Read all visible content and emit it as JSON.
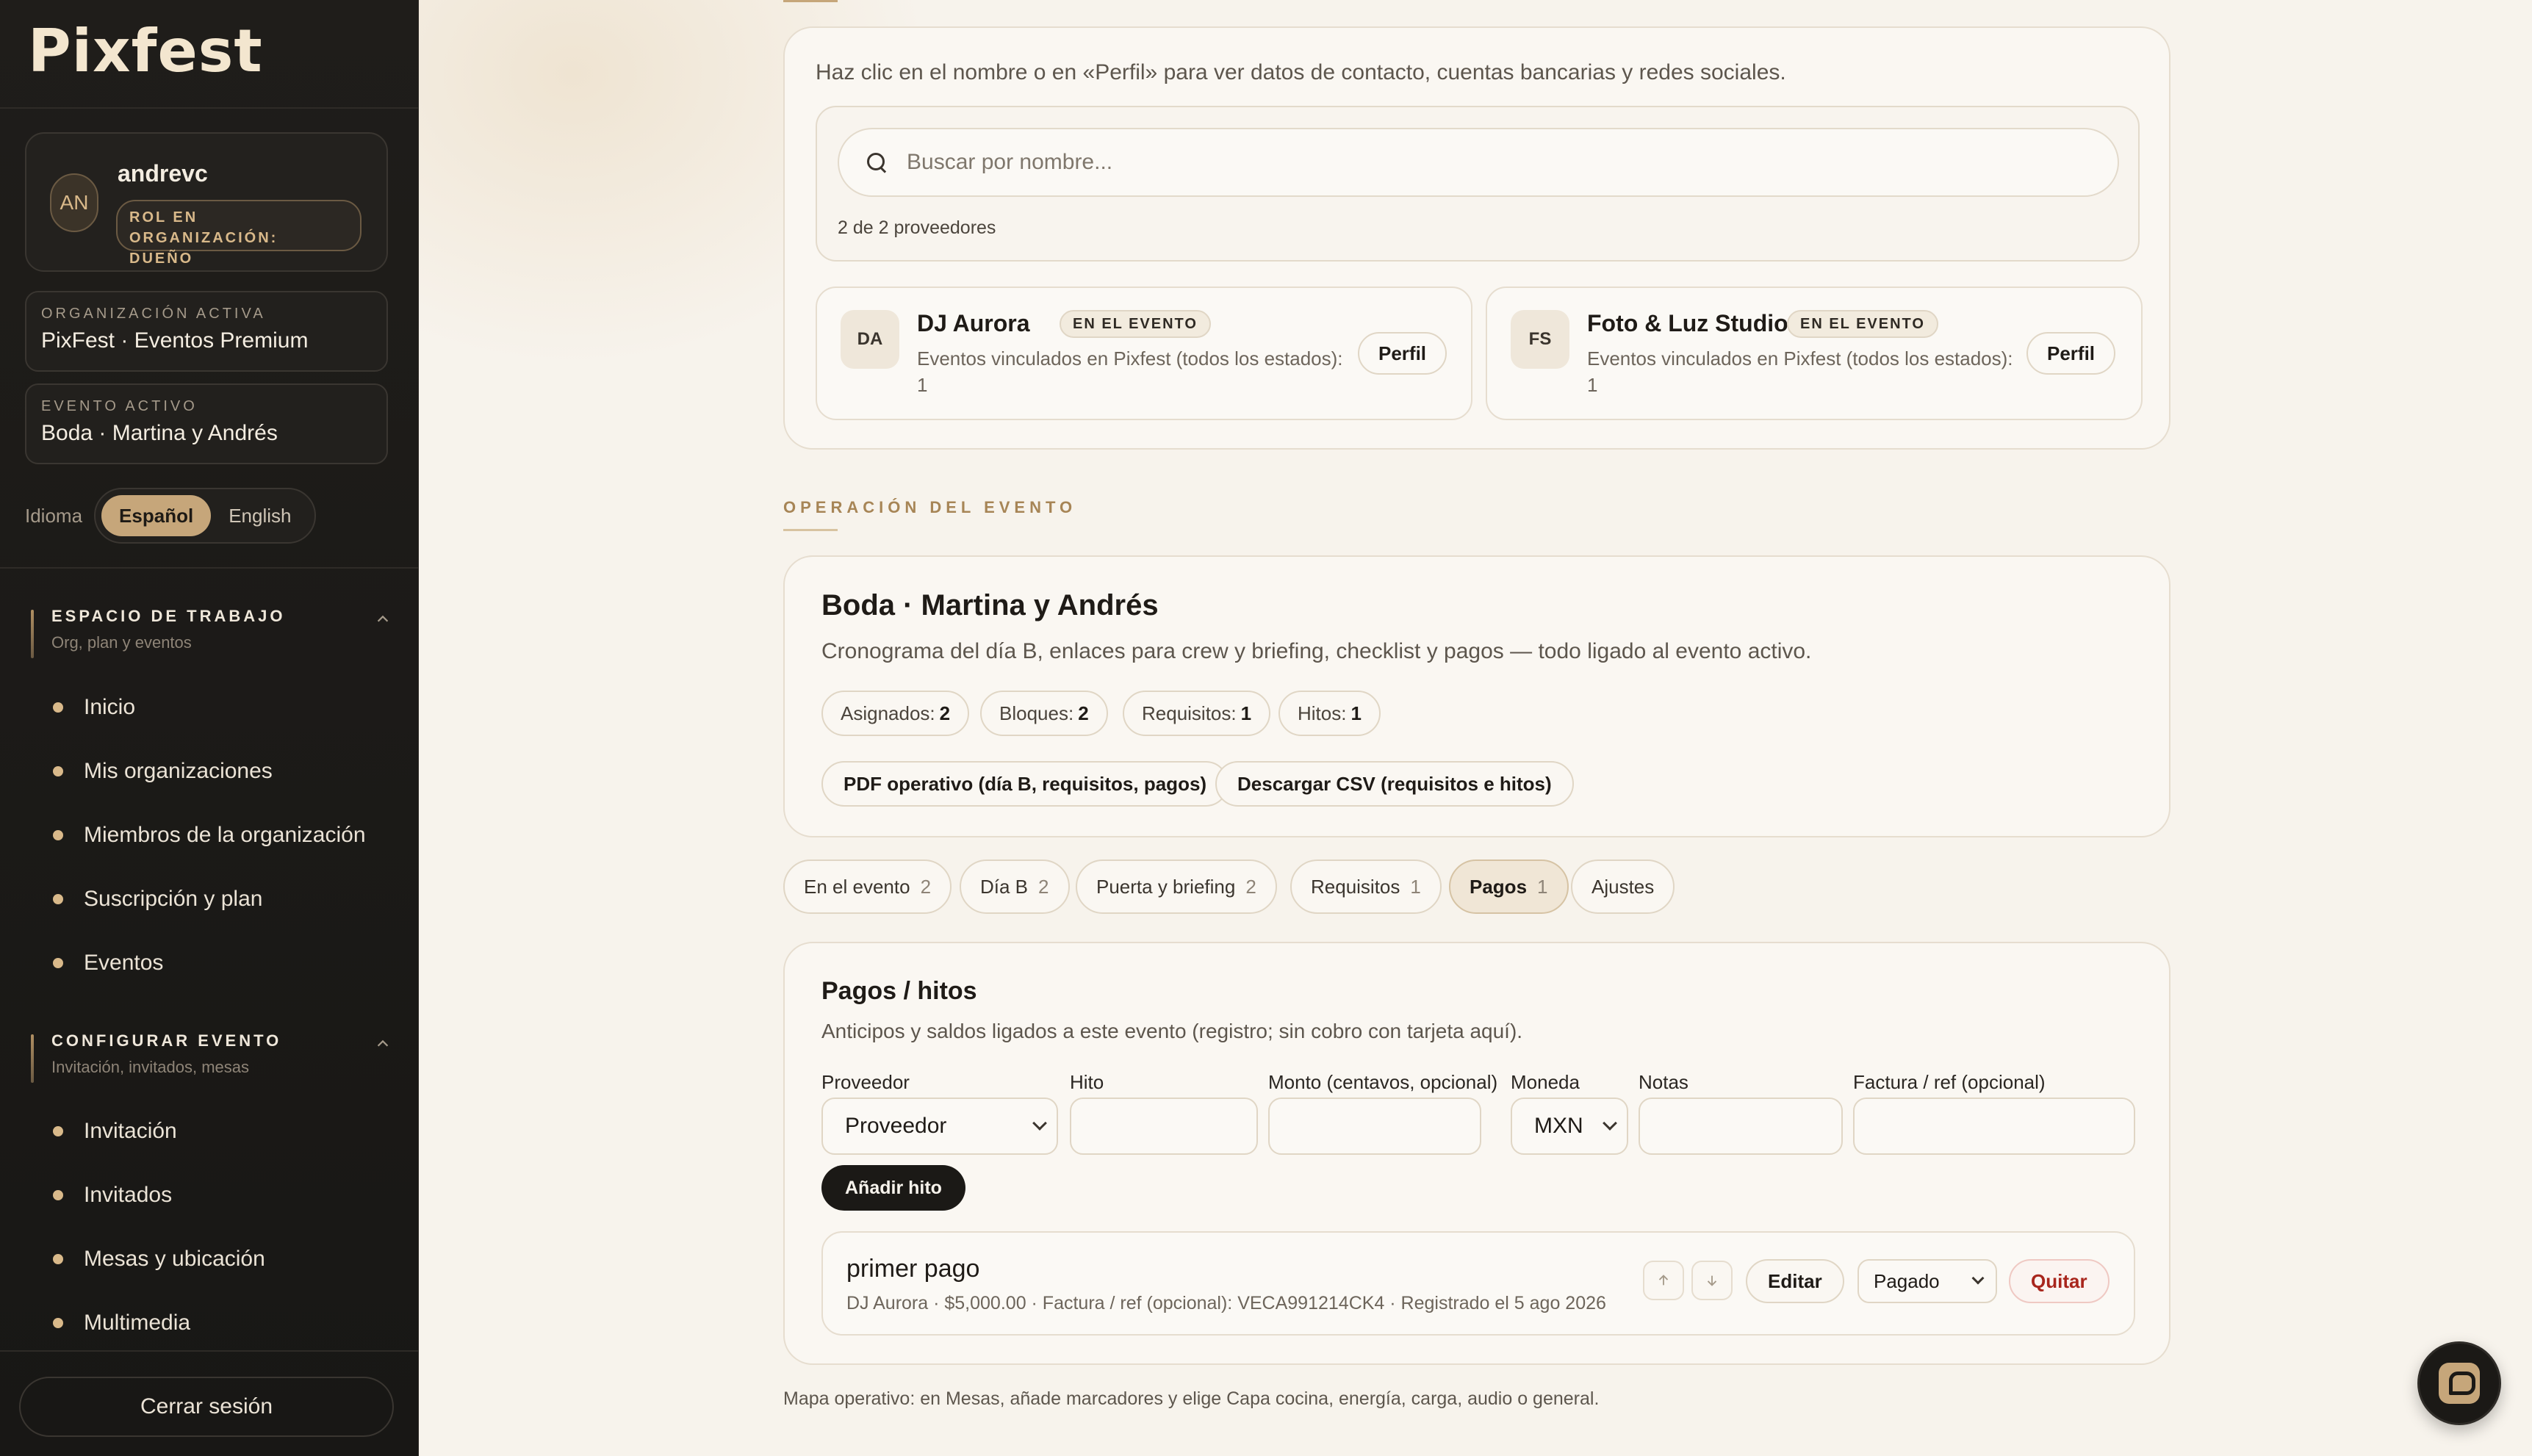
{
  "brand": {
    "logo_text": "Pixfest"
  },
  "user": {
    "initials": "AN",
    "name": "andrevc",
    "role": "ROL EN ORGANIZACIÓN: DUEÑO"
  },
  "context": {
    "org_label": "ORGANIZACIÓN ACTIVA",
    "org_value": "PixFest · Eventos Premium",
    "event_label": "EVENTO ACTIVO",
    "event_value": "Boda · Martina y Andrés"
  },
  "language": {
    "label": "Idioma",
    "options": [
      "Español",
      "English"
    ],
    "selected": "Español"
  },
  "sidebar": {
    "workspace": {
      "title": "ESPACIO DE TRABAJO",
      "subtitle": "Org, plan y eventos",
      "items": [
        "Inicio",
        "Mis organizaciones",
        "Miembros de la organización",
        "Suscripción y plan",
        "Eventos"
      ]
    },
    "configure": {
      "title": "CONFIGURAR EVENTO",
      "subtitle": "Invitación, invitados, mesas",
      "items": [
        "Invitación",
        "Invitados",
        "Mesas y ubicación",
        "Multimedia"
      ]
    },
    "logout_label": "Cerrar sesión"
  },
  "providers": {
    "intro": "Haz clic en el nombre o en «Perfil» para ver datos de contacto, cuentas bancarias y redes sociales.",
    "search_placeholder": "Buscar por nombre...",
    "count_text": "2 de 2 proveedores",
    "list": [
      {
        "initials": "DA",
        "name": "DJ Aurora",
        "badge": "EN EL EVENTO",
        "desc": "Eventos vinculados en Pixfest (todos los estados): 1",
        "profile_label": "Perfil"
      },
      {
        "initials": "FS",
        "name": "Foto & Luz Studio",
        "badge": "EN EL EVENTO",
        "desc": "Eventos vinculados en Pixfest (todos los estados): 1",
        "profile_label": "Perfil"
      }
    ]
  },
  "operation": {
    "section_label": "OPERACIÓN DEL EVENTO",
    "title": "Boda · Martina y Andrés",
    "subtitle": "Cronograma del día B, enlaces para crew y briefing, checklist y pagos — todo ligado al evento activo.",
    "stats": [
      {
        "label": "Asignados:",
        "value": "2"
      },
      {
        "label": "Bloques:",
        "value": "2"
      },
      {
        "label": "Requisitos:",
        "value": "1"
      },
      {
        "label": "Hitos:",
        "value": "1"
      }
    ],
    "actions": [
      "PDF operativo (día B, requisitos, pagos)",
      "Descargar CSV (requisitos e hitos)"
    ]
  },
  "tabs": [
    {
      "label": "En el evento",
      "count": "2"
    },
    {
      "label": "Día B",
      "count": "2"
    },
    {
      "label": "Puerta y briefing",
      "count": "2"
    },
    {
      "label": "Requisitos",
      "count": "1"
    },
    {
      "label": "Pagos",
      "count": "1"
    },
    {
      "label": "Ajustes",
      "count": ""
    }
  ],
  "active_tab": "Pagos",
  "payments": {
    "title": "Pagos / hitos",
    "subtitle": "Anticipos y saldos ligados a este evento (registro; sin cobro con tarjeta aquí).",
    "fields": {
      "provider_label": "Proveedor",
      "provider_value": "Proveedor",
      "milestone_label": "Hito",
      "milestone_value": "",
      "amount_label": "Monto (centavos, opcional)",
      "amount_value": "",
      "currency_label": "Moneda",
      "currency_value": "MXN",
      "notes_label": "Notas",
      "notes_value": "",
      "invoice_label": "Factura / ref (opcional)",
      "invoice_value": ""
    },
    "add_label": "Añadir hito",
    "rows": [
      {
        "title": "primer pago",
        "meta": "DJ Aurora · $5,000.00 · Factura / ref (opcional): VECA991214CK4 · Registrado el 5 ago 2026",
        "edit_label": "Editar",
        "status": "Pagado",
        "remove_label": "Quitar"
      }
    ]
  },
  "footer_note": "Mapa operativo: en Mesas, añade marcadores y elige Capa cocina, energía, carga, audio o general.",
  "icons": {
    "search": "search-icon",
    "up": "arrow-up-icon",
    "down": "arrow-down-icon",
    "chevron": "chevron-up-icon",
    "fab": "pixfest-chat-icon"
  },
  "colors": {
    "accent": "#c6a67a",
    "sidebar_bg": "#1c1a17",
    "page_bg": "#f7f3ec",
    "danger": "#a8261d"
  }
}
